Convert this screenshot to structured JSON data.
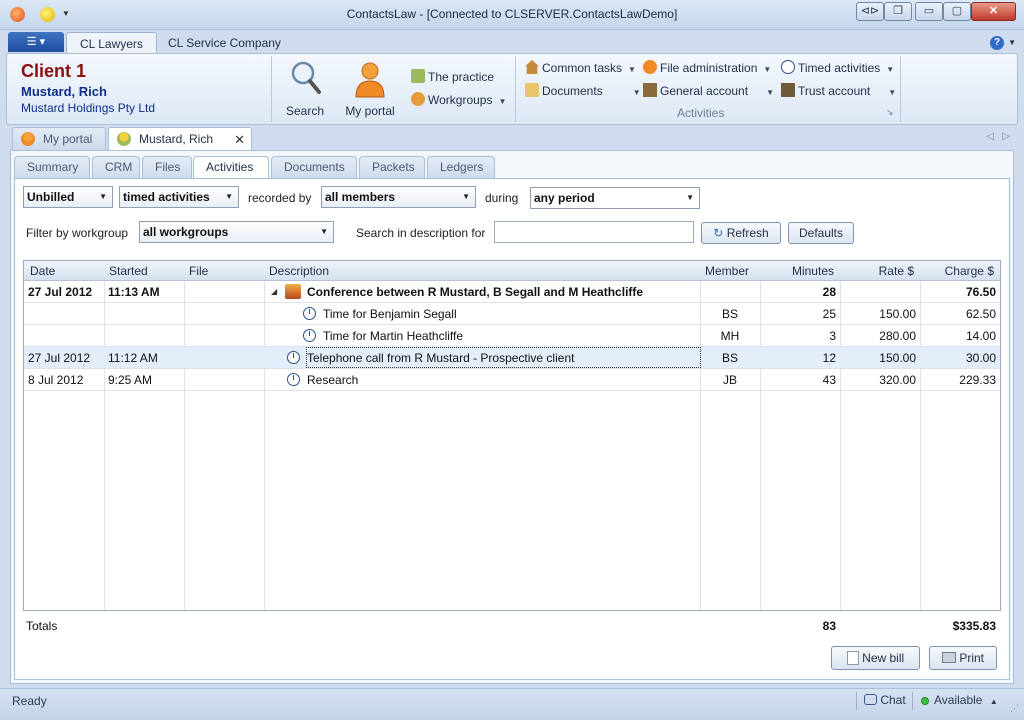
{
  "window": {
    "title": "ContactsLaw - [Connected to CLSERVER.ContactsLawDemo]",
    "controls": [
      "⊲⊳",
      "❐",
      "▭",
      "▢",
      "✕"
    ]
  },
  "ribbon_tabs": {
    "app_menu_icon": "app-menu-icon",
    "items": [
      "CL Lawyers",
      "CL Service Company"
    ],
    "active": "CL Lawyers",
    "help": "?"
  },
  "client": {
    "title": "Client 1",
    "name": "Mustard, Rich",
    "organisation": "Mustard Holdings Pty Ltd"
  },
  "ribbon": {
    "search_label": "Search",
    "portal_label": "My portal",
    "practice_label": "The practice",
    "workgroups_label": "Workgroups",
    "common_tasks": "Common tasks",
    "documents": "Documents",
    "file_administration": "File administration",
    "general_account": "General account",
    "timed_activities": "Timed activities",
    "trust_account": "Trust account",
    "activities_group": "Activities"
  },
  "doc_tabs": [
    {
      "label": "My portal"
    },
    {
      "label": "Mustard, Rich",
      "close": "✕"
    }
  ],
  "sub_tabs": [
    "Summary",
    "CRM",
    "Files",
    "Activities",
    "Documents",
    "Packets",
    "Ledgers"
  ],
  "active_sub_tab": "Activities",
  "filters": {
    "status": "Unbilled",
    "type": "timed activities",
    "recorded_by_label": "recorded by",
    "recorded_by": "all members",
    "during_label": "during",
    "period": "any period",
    "workgroup_label": "Filter by workgroup",
    "workgroup": "all workgroups",
    "search_label": "Search in description for",
    "search_value": "",
    "refresh": "Refresh",
    "defaults": "Defaults"
  },
  "grid": {
    "columns": [
      "Date",
      "Started",
      "File",
      "Description",
      "Member",
      "Minutes",
      "Rate $",
      "Charge $"
    ],
    "rows": [
      {
        "date": "27 Jul 2012",
        "started": "11:13 AM",
        "file": "",
        "description": "Conference between R Mustard, B Segall and M Heathcliffe",
        "member": "",
        "minutes": "28",
        "rate": "",
        "charge": "76.50"
      },
      {
        "date": "",
        "started": "",
        "file": "",
        "description": "Time for Benjamin Segall",
        "member": "BS",
        "minutes": "25",
        "rate": "150.00",
        "charge": "62.50"
      },
      {
        "date": "",
        "started": "",
        "file": "",
        "description": "Time for Martin Heathcliffe",
        "member": "MH",
        "minutes": "3",
        "rate": "280.00",
        "charge": "14.00"
      },
      {
        "date": "27 Jul 2012",
        "started": "11:12 AM",
        "file": "",
        "description": "Telephone call from R Mustard - Prospective client",
        "member": "BS",
        "minutes": "12",
        "rate": "150.00",
        "charge": "30.00"
      },
      {
        "date": "8 Jul 2012",
        "started": "9:25 AM",
        "file": "",
        "description": "Research",
        "member": "JB",
        "minutes": "43",
        "rate": "320.00",
        "charge": "229.33"
      }
    ]
  },
  "totals": {
    "label": "Totals",
    "minutes": "83",
    "charge": "$335.83"
  },
  "buttons": {
    "new_bill": "New bill",
    "print": "Print"
  },
  "status": {
    "text": "Ready",
    "chat": "Chat",
    "availability": "Available"
  }
}
